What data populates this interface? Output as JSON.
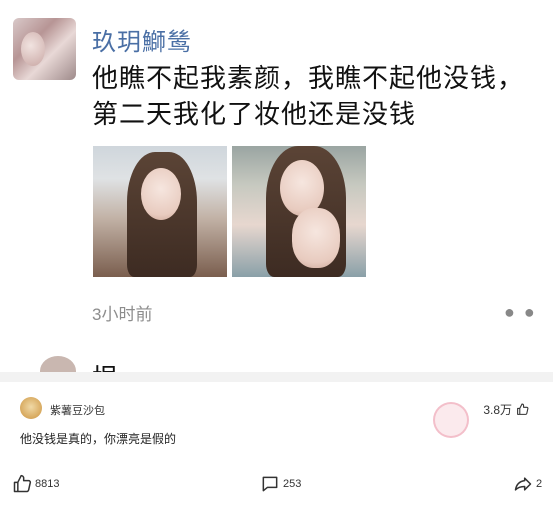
{
  "post": {
    "author": "玖玥鰤鸶",
    "text": "他瞧不起我素颜，我瞧不起他没钱，第二天我化了妆他还是没钱",
    "time": "3小时前",
    "next_item_partial": "垠"
  },
  "comment": {
    "author": "紫薯豆沙包",
    "likes": "3.8万",
    "text": "他没钱是真的，你漂亮是假的"
  },
  "actions": {
    "likes": "8813",
    "comments": "253",
    "shares": "2"
  },
  "icons": [
    "thumbs-up-icon",
    "comment-bubble-icon",
    "share-arrow-icon",
    "more-dots-icon"
  ],
  "colors": {
    "username": "#4a6fa5",
    "time": "#8d8d8d",
    "divider": "#f2f2f2"
  }
}
